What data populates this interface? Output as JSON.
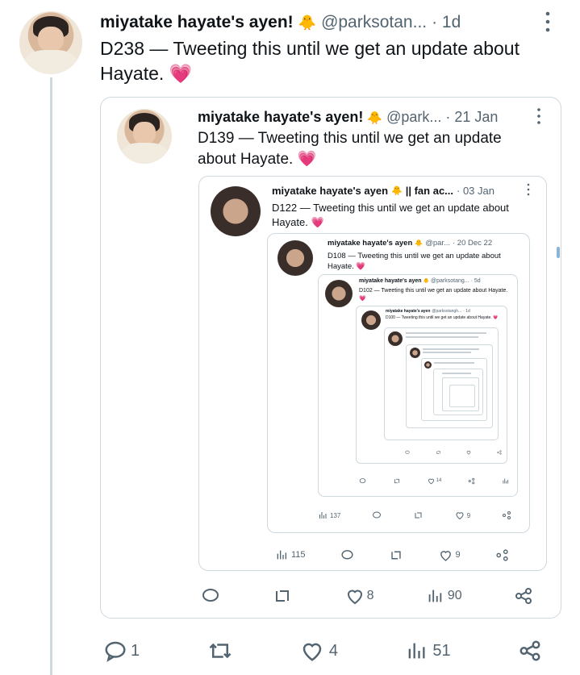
{
  "colors": {
    "text": "#0f1419",
    "muted": "#536471",
    "border": "#cfd9de",
    "heart": "#e0245e"
  },
  "tweet": {
    "display_name": "miyatake hayate's ayen!",
    "handle": "@parksotan...",
    "time": "· 1d",
    "text": "D238 — Tweeting this until we get an update about Hayate.",
    "emoji": "💗",
    "replies": "1",
    "likes": "4",
    "views": "51"
  },
  "quote1": {
    "display_name": "miyatake hayate's ayen!",
    "handle": "@park...",
    "time": "· 21 Jan",
    "text": "D139 — Tweeting this until we get an update about Hayate.",
    "emoji": "💗",
    "likes": "8",
    "views": "90"
  },
  "quote2": {
    "display_name": "miyatake hayate's ayen",
    "suffix": "|| fan ac...",
    "time": "· 03 Jan",
    "text": "D122 — Tweeting this until we get an update about Hayate.",
    "emoji": "💗",
    "likes": "9",
    "views": "115"
  },
  "quote3": {
    "display_name": "miyatake hayate's ayen",
    "handle": "@par...",
    "time": "· 20 Dec 22",
    "text": "D108 — Tweeting this until we get an update about Hayate.",
    "emoji": "💗",
    "likes": "9",
    "views": "137"
  },
  "quote4": {
    "display_name": "miyatake hayate's ayen",
    "handle": "@parksotang...",
    "time": "· 5d",
    "text": "D102 — Tweeting this until we get an update about Hayate.",
    "emoji": "💗",
    "likes": "14"
  },
  "quote5": {
    "display_name": "miyatake hayate's ayen",
    "handle": "@parksotangh...",
    "time": "· 1d",
    "text": "D100 — Tweeting this until we get an update about Hayate.",
    "emoji": "💗"
  },
  "icons": [
    "more-icon",
    "reply-icon",
    "retweet-icon",
    "like-icon",
    "views-icon",
    "share-icon",
    "chick-emoji-icon",
    "heart-emoji-icon"
  ]
}
